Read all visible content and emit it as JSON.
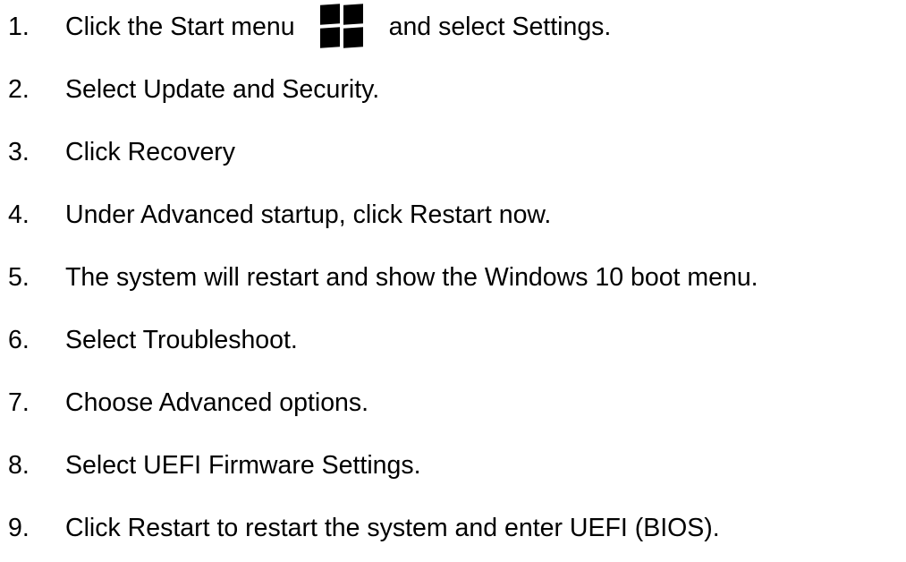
{
  "instructions": {
    "steps": [
      {
        "number": "1.",
        "text_before_icon": "Click the Start menu",
        "icon": "windows-logo-icon",
        "text_after_icon": "and select Settings."
      },
      {
        "number": "2.",
        "text": "Select Update and Security."
      },
      {
        "number": "3.",
        "text": "Click Recovery"
      },
      {
        "number": "4.",
        "text": "Under Advanced startup, click Restart now."
      },
      {
        "number": "5.",
        "text": "The system will restart and show the Windows 10 boot menu."
      },
      {
        "number": "6.",
        "text": "Select Troubleshoot."
      },
      {
        "number": "7.",
        "text": "Choose Advanced options."
      },
      {
        "number": "8.",
        "text": "Select UEFI Firmware Settings."
      },
      {
        "number": "9.",
        "text": "Click Restart to restart the system and enter UEFI (BIOS)."
      }
    ]
  }
}
